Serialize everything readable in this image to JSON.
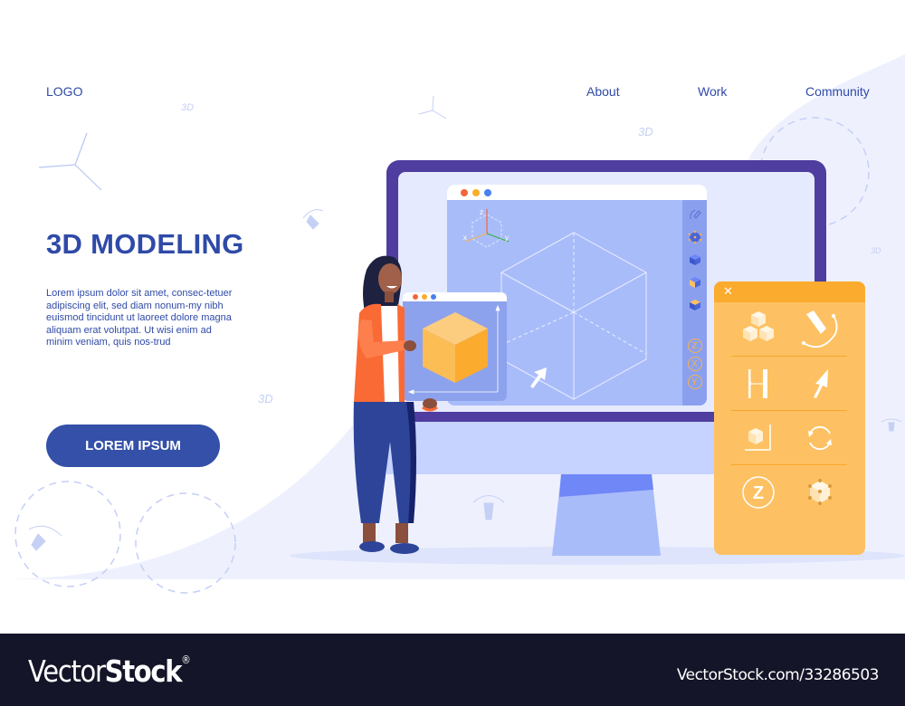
{
  "nav": {
    "logo": "LOGO",
    "links": [
      "About",
      "Work",
      "Community"
    ]
  },
  "hero": {
    "title": "3D MODELING",
    "body": "Lorem ipsum dolor sit amet, consec-tetuer adipiscing elit, sed diam nonum-my nibh euismod tincidunt ut laoreet dolore magna aliquam erat volutpat. Ut wisi enim ad minim veniam, quis nos-trud",
    "cta_label": "LOREM IPSUM"
  },
  "decorations": {
    "label_3d": "3D",
    "axis_labels": [
      "x",
      "y",
      "z"
    ]
  },
  "app_window": {
    "traffic_lights": [
      "red",
      "yellow",
      "blue"
    ],
    "axis_gizmo_labels": {
      "x": "x",
      "y": "y",
      "z": "z"
    },
    "sidebar_tools": [
      "pen-tool",
      "vertex-select",
      "solid-cube",
      "face-select",
      "top-face-select"
    ],
    "axis_buttons": [
      "Z",
      "X",
      "Y"
    ]
  },
  "tool_panel": {
    "close_symbol": "✕",
    "rows": [
      [
        "cubes-stack",
        "pen-curve"
      ],
      [
        "width-measure",
        "cursor-pointer"
      ],
      [
        "cube-axes",
        "rotate"
      ],
      [
        "z-axis",
        "cube-vertices"
      ]
    ],
    "z_label": "Z"
  },
  "colors": {
    "brand_blue": "#2f4aa7",
    "monitor_frame": "#4f3da0",
    "panel_orange": "#fdc163",
    "panel_header": "#fbab2e",
    "footer_bg": "#141528"
  },
  "footer": {
    "brand_light": "Vector",
    "brand_bold": "Stock",
    "brand_mark": "®",
    "image_id": "VectorStock.com/33286503"
  }
}
